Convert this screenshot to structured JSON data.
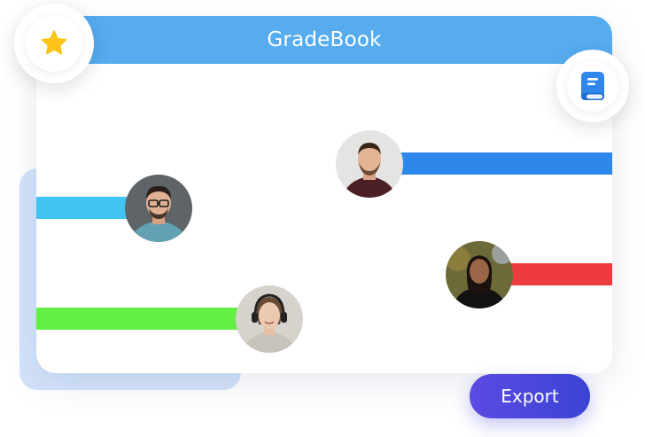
{
  "app": {
    "title": "GradeBook"
  },
  "badges": {
    "left": "star-icon",
    "right": "book-icon"
  },
  "rows": [
    {
      "name": "bar-blue",
      "color": "#2e88ec"
    },
    {
      "name": "bar-cyan",
      "color": "#41c4f2"
    },
    {
      "name": "bar-red",
      "color": "#ee3b3e"
    },
    {
      "name": "bar-green",
      "color": "#62f045"
    }
  ],
  "colors": {
    "header": "#56acef",
    "star": "#fcc419",
    "book": "#2e88ec",
    "export_gradient": [
      "#5b4be3",
      "#3b43d3"
    ],
    "back_panel": "#d3e3fb"
  },
  "actions": {
    "export_label": "Export"
  }
}
